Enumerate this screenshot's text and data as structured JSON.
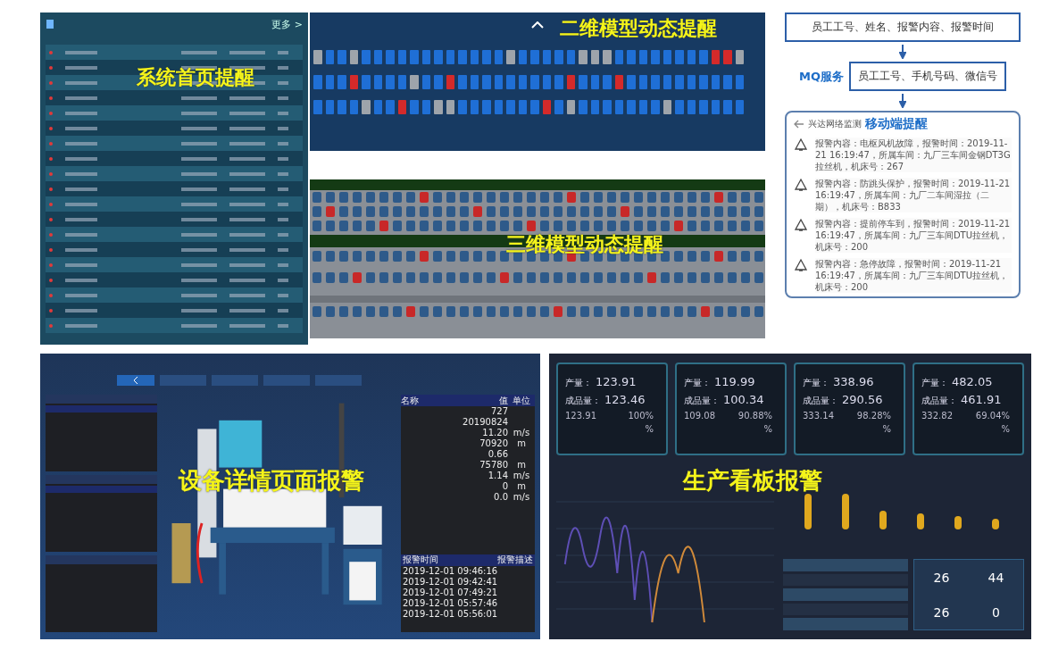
{
  "home_alerts": {
    "label": "系统首页提醒",
    "more": "更多 >"
  },
  "model_2d": {
    "label": "二维模型动态提醒",
    "rows": [
      [
        {
          "color": "#9ea4ab"
        },
        {
          "color": "#1f6fd6"
        },
        {
          "color": "#1f6fd6"
        },
        {
          "color": "#9ea4ab"
        },
        {
          "color": "#1f6fd6"
        },
        {
          "color": "#1f6fd6"
        },
        {
          "color": "#1f6fd6"
        },
        {
          "color": "#1f6fd6"
        },
        {
          "color": "#1f6fd6"
        },
        {
          "color": "#1f6fd6"
        },
        {
          "color": "#1f6fd6"
        },
        {
          "color": "#1f6fd6"
        },
        {
          "color": "#1f6fd6"
        },
        {
          "color": "#1f6fd6"
        },
        {
          "color": "#1f6fd6"
        },
        {
          "color": "#1f6fd6"
        },
        {
          "color": "#9ea4ab"
        },
        {
          "color": "#1f6fd6"
        },
        {
          "color": "#1f6fd6"
        },
        {
          "color": "#1f6fd6"
        },
        {
          "color": "#1f6fd6"
        },
        {
          "color": "#1f6fd6"
        },
        {
          "color": "#9ea4ab"
        },
        {
          "color": "#9ea4ab"
        },
        {
          "color": "#9ea4ab"
        },
        {
          "color": "#1f6fd6"
        },
        {
          "color": "#1f6fd6"
        },
        {
          "color": "#1f6fd6"
        },
        {
          "color": "#1f6fd6"
        },
        {
          "color": "#1f6fd6"
        },
        {
          "color": "#1f6fd6"
        },
        {
          "color": "#1f6fd6"
        },
        {
          "color": "#1f6fd6"
        },
        {
          "color": "#d42a2a"
        },
        {
          "color": "#d42a2a"
        },
        {
          "color": "#9ea4ab"
        }
      ],
      [
        {
          "color": "#1f6fd6"
        },
        {
          "color": "#1f6fd6"
        },
        {
          "color": "#1f6fd6"
        },
        {
          "color": "#d42a2a"
        },
        {
          "color": "#1f6fd6"
        },
        {
          "color": "#1f6fd6"
        },
        {
          "color": "#1f6fd6"
        },
        {
          "color": "#1f6fd6"
        },
        {
          "color": "#9ea4ab"
        },
        {
          "color": "#1f6fd6"
        },
        {
          "color": "#1f6fd6"
        },
        {
          "color": "#d42a2a"
        },
        {
          "color": "#1f6fd6"
        },
        {
          "color": "#1f6fd6"
        },
        {
          "color": "#1f6fd6"
        },
        {
          "color": "#1f6fd6"
        },
        {
          "color": "#1f6fd6"
        },
        {
          "color": "#1f6fd6"
        },
        {
          "color": "#1f6fd6"
        },
        {
          "color": "#1f6fd6"
        },
        {
          "color": "#1f6fd6"
        },
        {
          "color": "#d42a2a"
        },
        {
          "color": "#1f6fd6"
        },
        {
          "color": "#1f6fd6"
        },
        {
          "color": "#1f6fd6"
        },
        {
          "color": "#d42a2a"
        },
        {
          "color": "#1f6fd6"
        },
        {
          "color": "#1f6fd6"
        },
        {
          "color": "#1f6fd6"
        },
        {
          "color": "#1f6fd6"
        },
        {
          "color": "#1f6fd6"
        },
        {
          "color": "#1f6fd6"
        },
        {
          "color": "#1f6fd6"
        },
        {
          "color": "#1f6fd6"
        },
        {
          "color": "#1f6fd6"
        },
        {
          "color": "#1f6fd6"
        }
      ],
      [
        {
          "color": "#1f6fd6"
        },
        {
          "color": "#1f6fd6"
        },
        {
          "color": "#1f6fd6"
        },
        {
          "color": "#1f6fd6"
        },
        {
          "color": "#9ea4ab"
        },
        {
          "color": "#1f6fd6"
        },
        {
          "color": "#1f6fd6"
        },
        {
          "color": "#d42a2a"
        },
        {
          "color": "#1f6fd6"
        },
        {
          "color": "#1f6fd6"
        },
        {
          "color": "#9ea4ab"
        },
        {
          "color": "#9ea4ab"
        },
        {
          "color": "#1f6fd6"
        },
        {
          "color": "#1f6fd6"
        },
        {
          "color": "#1f6fd6"
        },
        {
          "color": "#1f6fd6"
        },
        {
          "color": "#1f6fd6"
        },
        {
          "color": "#1f6fd6"
        },
        {
          "color": "#1f6fd6"
        },
        {
          "color": "#d42a2a"
        },
        {
          "color": "#1f6fd6"
        },
        {
          "color": "#9ea4ab"
        },
        {
          "color": "#1f6fd6"
        },
        {
          "color": "#1f6fd6"
        },
        {
          "color": "#1f6fd6"
        },
        {
          "color": "#1f6fd6"
        },
        {
          "color": "#1f6fd6"
        },
        {
          "color": "#1f6fd6"
        },
        {
          "color": "#1f6fd6"
        },
        {
          "color": "#9ea4ab"
        },
        {
          "color": "#1f6fd6"
        },
        {
          "color": "#1f6fd6"
        },
        {
          "color": "#1f6fd6"
        },
        {
          "color": "#1f6fd6"
        },
        {
          "color": "#1f6fd6"
        },
        {
          "color": "#1f6fd6"
        }
      ]
    ]
  },
  "model_3d": {
    "label": "三维模型动态提醒"
  },
  "mobile": {
    "fields_box": "员工工号、姓名、报警内容、报警时间",
    "service": "MQ服务",
    "contacts_box": "员工工号、手机号码、微信号",
    "app_title": "兴达网络监测",
    "label": "移动端提醒",
    "alerts": [
      "报警内容：电枢风机故障，报警时间：2019-11-21 16:19:47，所属车间：九厂三车间金钢DT3G拉丝机，机床号：267",
      "报警内容：防跳头保护，报警时间：2019-11-21 16:19:47，所属车间：九厂二车间湿拉（二期），机床号：B833",
      "报警内容：提前停车到，报警时间：2019-11-21 16:19:47，所属车间：九厂三车间DTU拉丝机，机床号：200",
      "报警内容：急停故障，报警时间：2019-11-21 16:19:47，所属车间：九厂三车间DTU拉丝机，机床号：200"
    ]
  },
  "device": {
    "label": "设备详情页面报警",
    "params_header": [
      "名称",
      "值",
      "单位"
    ],
    "params": [
      {
        "value": "727"
      },
      {
        "value": "20190824"
      },
      {
        "value": "11.20",
        "unit": "m/s"
      },
      {
        "value": "70920",
        "unit": "m"
      },
      {
        "value": "0.66"
      },
      {
        "value": "75780",
        "unit": "m"
      },
      {
        "value": "1.14",
        "unit": "m/s"
      },
      {
        "value": "0",
        "unit": "m"
      },
      {
        "value": "0.0",
        "unit": "m/s"
      }
    ],
    "alarm_header": [
      "报警时间",
      "报警描述"
    ],
    "alarm_times": [
      "2019-12-01 09:46:16",
      "2019-12-01 09:42:41",
      "2019-12-01 07:49:21",
      "2019-12-01 05:57:46",
      "2019-12-01 05:56:01"
    ]
  },
  "board": {
    "label": "生产看板报警",
    "cards": [
      {
        "output_label": "产量：",
        "output": "123.91",
        "good_label": "成品量：",
        "good": "123.46",
        "total": "123.91",
        "rate": "100%",
        "unit": "%"
      },
      {
        "output_label": "产量：",
        "output": "119.99",
        "good_label": "成品量：",
        "good": "100.34",
        "total": "109.08",
        "rate": "90.88%",
        "unit": "%"
      },
      {
        "output_label": "产量：",
        "output": "338.96",
        "good_label": "成品量：",
        "good": "290.56",
        "total": "333.14",
        "rate": "98.28%",
        "unit": "%"
      },
      {
        "output_label": "产量：",
        "output": "482.05",
        "good_label": "成品量：",
        "good": "461.91",
        "total": "332.82",
        "rate": "69.04%",
        "unit": "%"
      }
    ],
    "summary": [
      "26",
      "44",
      "26",
      "0"
    ]
  }
}
